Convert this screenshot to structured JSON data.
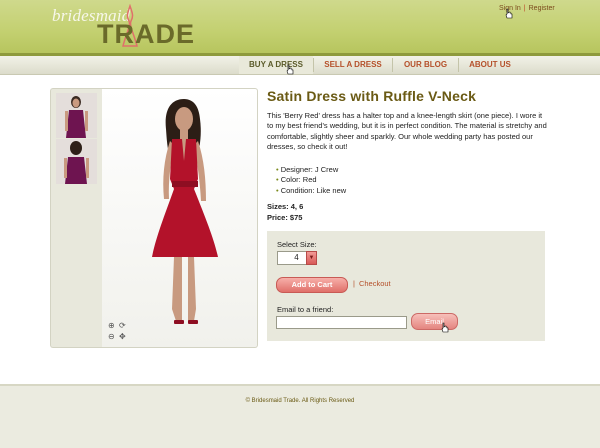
{
  "brand": {
    "logo_top": "bridesmaid",
    "logo_bottom": "TRADE"
  },
  "auth": {
    "sign_in": "Sign In",
    "register": "Register"
  },
  "nav": [
    {
      "label": "BUY A DRESS"
    },
    {
      "label": "SELL A DRESS"
    },
    {
      "label": "OUR BLOG"
    },
    {
      "label": "ABOUT US"
    }
  ],
  "product": {
    "title": "Satin Dress with Ruffle V-Neck",
    "description": "This 'Berry Red' dress has a halter top and a knee-length skirt (one piece).  I wore it to my best friend's wedding, but it is in perfect condition.  The material is stretchy and comfortable, slightly sheer and sparkly.  Our whole wedding party has posted our dresses, so check it out!",
    "specs": [
      "Designer: J Crew",
      "Color: Red",
      "Condition: Like new"
    ],
    "sizes": "Sizes: 4, 6",
    "price": "Price: $75",
    "dress_color": "#b3122a"
  },
  "purchase": {
    "select_size_label": "Select Size:",
    "selected_size": "4",
    "add_to_cart": "Add to Cart",
    "checkout": "Checkout",
    "email_label": "Email to a friend:",
    "email_value": "",
    "email_button": "Email"
  },
  "footer": {
    "copyright": "© Bridesmaid Trade. All Rights Reserved"
  },
  "colors": {
    "header": "#c3d070",
    "accent": "#b5502a",
    "title": "#6a5a14",
    "panel": "#e8e8dc"
  }
}
